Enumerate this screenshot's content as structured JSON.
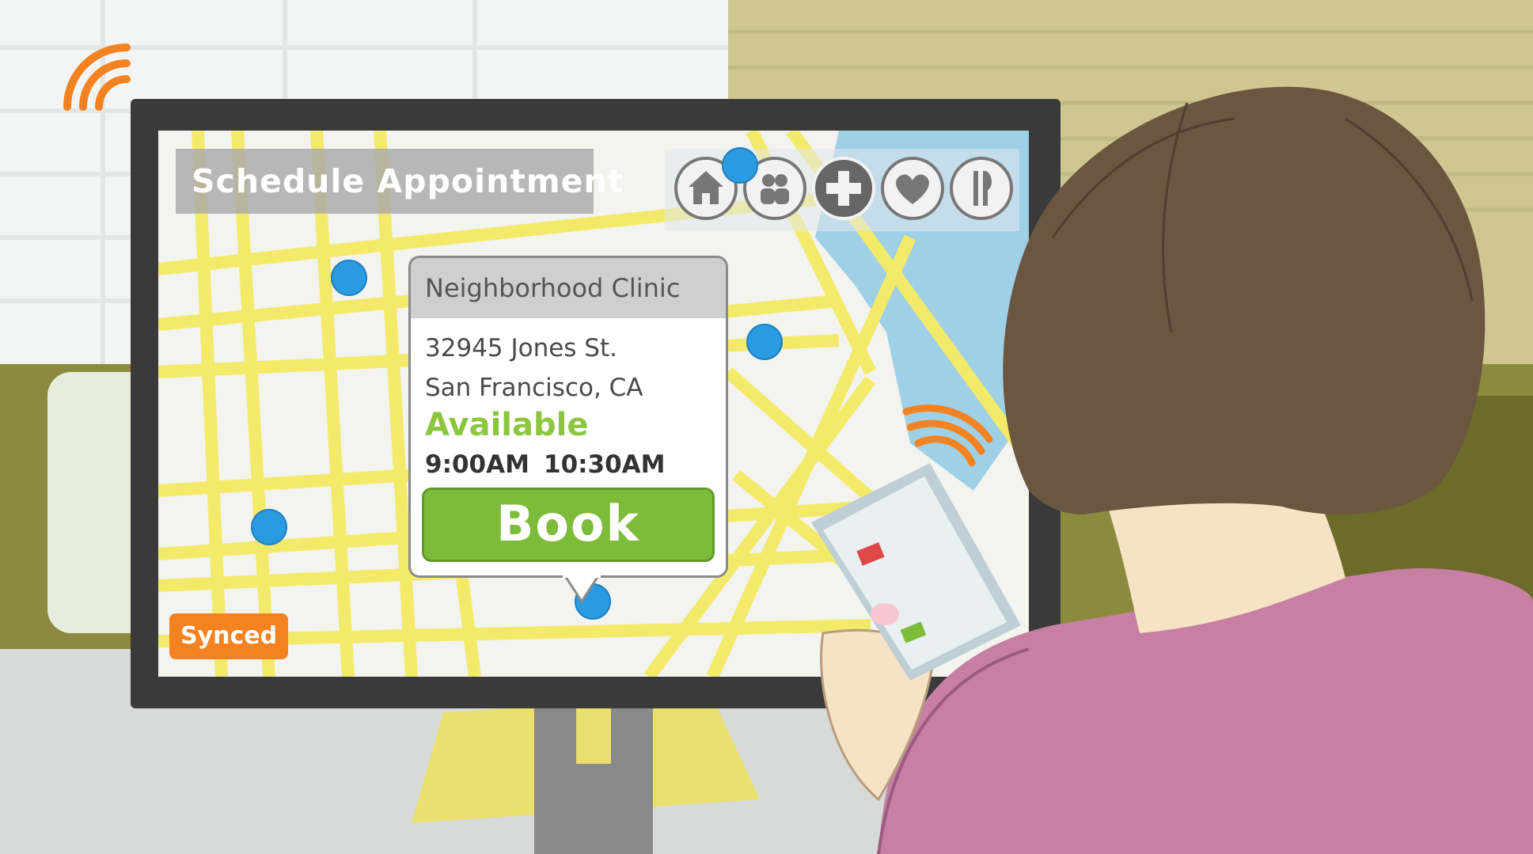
{
  "app": {
    "title": "Schedule Appointment",
    "status_badge": "Synced"
  },
  "categories": [
    {
      "icon": "home-icon",
      "active": false
    },
    {
      "icon": "people-icon",
      "active": false
    },
    {
      "icon": "medical-cross-icon",
      "active": true
    },
    {
      "icon": "heart-icon",
      "active": false
    },
    {
      "icon": "dining-icon",
      "active": false
    }
  ],
  "popup": {
    "clinic_name": "Neighborhood Clinic",
    "address_line1": "32945 Jones St.",
    "address_line2": "San Francisco, CA",
    "availability": "Available",
    "slots": [
      "9:00AM",
      "10:30AM"
    ],
    "book_label": "Book"
  },
  "colors": {
    "accent_orange": "#f58220",
    "available_green": "#8cc63f",
    "book_green": "#7dbb3a",
    "map_road": "#f4ea6a",
    "map_water": "#9fd0e6",
    "pin_blue": "#2b9be0",
    "shirt_pink": "#c77fa3",
    "hair_brown": "#6b5640"
  }
}
